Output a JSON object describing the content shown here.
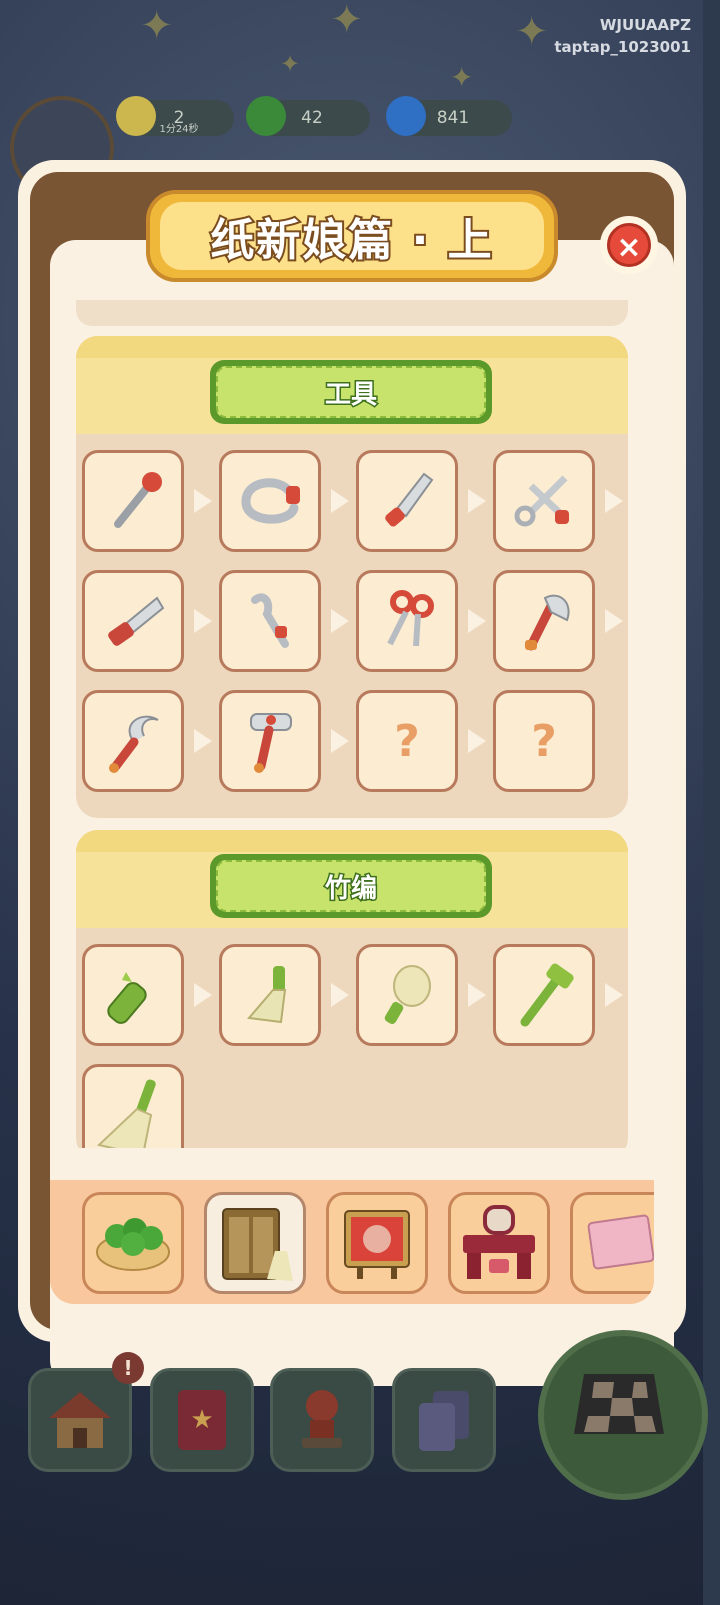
{
  "watermark": {
    "line1": "WJUUAAPZ",
    "line2": "taptap_1023001"
  },
  "resources": [
    {
      "value": "2",
      "sub": "1分24秒",
      "icon": "energy-icon",
      "color": "#d8c35a"
    },
    {
      "value": "42",
      "icon": "coin-icon",
      "color": "#3a9a3a"
    },
    {
      "value": "841",
      "icon": "fire-icon",
      "color": "#3a7ad0"
    }
  ],
  "panel": {
    "title": "纸新娘篇 · 上",
    "close_icon": "close-icon"
  },
  "sections": [
    {
      "name": "工具",
      "items": [
        {
          "icon": "pin-tool-icon",
          "unlocked": true
        },
        {
          "icon": "bent-wire-icon",
          "unlocked": true
        },
        {
          "icon": "knife-icon",
          "unlocked": true
        },
        {
          "icon": "scissors-icon",
          "unlocked": true
        },
        {
          "icon": "saw-icon",
          "unlocked": true
        },
        {
          "icon": "hook-blade-icon",
          "unlocked": true
        },
        {
          "icon": "red-scissors-icon",
          "unlocked": true
        },
        {
          "icon": "axe-icon",
          "unlocked": true
        },
        {
          "icon": "sickle-icon",
          "unlocked": true
        },
        {
          "icon": "rake-icon",
          "unlocked": true
        },
        {
          "icon": "unknown-item-icon",
          "unlocked": false,
          "label": "?"
        },
        {
          "icon": "unknown-item-icon",
          "unlocked": false,
          "label": "?"
        }
      ]
    },
    {
      "name": "竹编",
      "items": [
        {
          "icon": "bamboo-segment-icon",
          "unlocked": true
        },
        {
          "icon": "bamboo-whisk-icon",
          "unlocked": true
        },
        {
          "icon": "bamboo-brush-icon",
          "unlocked": true
        },
        {
          "icon": "bamboo-hammer-icon",
          "unlocked": true
        },
        {
          "icon": "bamboo-broom-icon",
          "unlocked": true
        }
      ]
    }
  ],
  "tabs": [
    {
      "icon": "coin-bowl-icon",
      "active": false
    },
    {
      "icon": "cabinet-icon",
      "active": true
    },
    {
      "icon": "red-screen-icon",
      "active": false
    },
    {
      "icon": "vanity-table-icon",
      "active": false
    },
    {
      "icon": "pink-box-icon",
      "active": false
    }
  ],
  "bottom_nav": [
    {
      "icon": "home-icon"
    },
    {
      "icon": "book-icon"
    },
    {
      "icon": "stamp-icon"
    },
    {
      "icon": "cards-icon"
    }
  ],
  "badge": "!",
  "colors": {
    "brown": "#7a5534",
    "paper": "#faf1e2",
    "title_gold": "#f0b83a",
    "green": "#c7e36c",
    "close_red": "#e64a3b"
  }
}
